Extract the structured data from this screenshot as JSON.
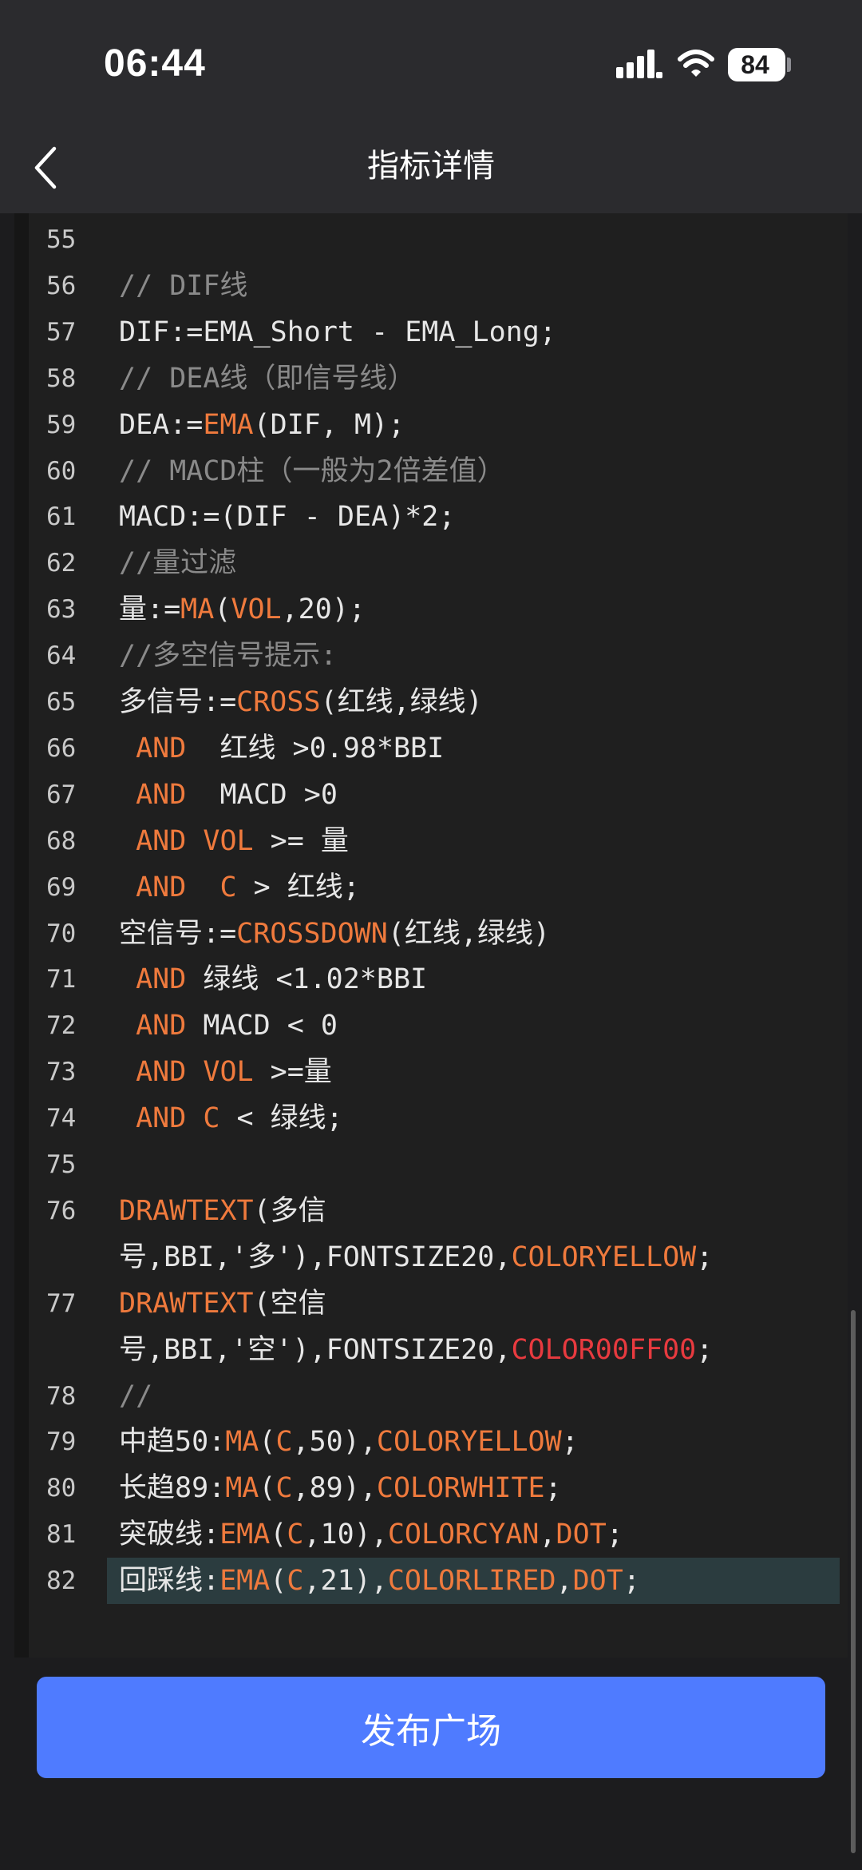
{
  "status_bar": {
    "time": "06:44",
    "battery": "84"
  },
  "nav": {
    "title": "指标详情"
  },
  "publish": {
    "label": "发布广场"
  },
  "colors": {
    "accent": "#4f7bff",
    "keyword": "#ef7a3d",
    "red": "#e83a3f",
    "comment": "#8a8a8a"
  },
  "code": [
    {
      "n": "55",
      "segs": []
    },
    {
      "n": "56",
      "segs": [
        [
          "cm",
          "// DIF线"
        ]
      ]
    },
    {
      "n": "57",
      "segs": [
        [
          "",
          "DIF:=EMA_Short - EMA_Long;"
        ]
      ]
    },
    {
      "n": "58",
      "segs": [
        [
          "cm",
          "// DEA线（即信号线）"
        ]
      ]
    },
    {
      "n": "59",
      "segs": [
        [
          "",
          "DEA:="
        ],
        [
          "kw",
          "EMA"
        ],
        [
          "",
          "(DIF, M);"
        ]
      ]
    },
    {
      "n": "60",
      "segs": [
        [
          "cm",
          "// MACD柱（一般为2倍差值）"
        ]
      ]
    },
    {
      "n": "61",
      "segs": [
        [
          "",
          "MACD:=(DIF - DEA)*2;"
        ]
      ]
    },
    {
      "n": "62",
      "segs": [
        [
          "cm",
          "//量过滤"
        ]
      ]
    },
    {
      "n": "63",
      "segs": [
        [
          "",
          "量:="
        ],
        [
          "kw",
          "MA"
        ],
        [
          "",
          "("
        ],
        [
          "kw",
          "VOL"
        ],
        [
          "",
          ",20);"
        ]
      ]
    },
    {
      "n": "64",
      "segs": [
        [
          "cm",
          "//多空信号提示:"
        ]
      ]
    },
    {
      "n": "65",
      "segs": [
        [
          "",
          "多信号:="
        ],
        [
          "kw",
          "CROSS"
        ],
        [
          "",
          "(红线,绿线)"
        ]
      ]
    },
    {
      "n": "66",
      "segs": [
        [
          "",
          " "
        ],
        [
          "kw",
          "AND"
        ],
        [
          "",
          "  红线 >0.98*BBI"
        ]
      ]
    },
    {
      "n": "67",
      "segs": [
        [
          "",
          " "
        ],
        [
          "kw",
          "AND"
        ],
        [
          "",
          "  MACD >0"
        ]
      ]
    },
    {
      "n": "68",
      "segs": [
        [
          "",
          " "
        ],
        [
          "kw",
          "AND"
        ],
        [
          "",
          " "
        ],
        [
          "kw",
          "VOL"
        ],
        [
          "",
          " >= 量"
        ]
      ]
    },
    {
      "n": "69",
      "segs": [
        [
          "",
          " "
        ],
        [
          "kw",
          "AND"
        ],
        [
          "",
          "  "
        ],
        [
          "kw",
          "C"
        ],
        [
          "",
          " > 红线;"
        ]
      ]
    },
    {
      "n": "70",
      "segs": [
        [
          "",
          "空信号:="
        ],
        [
          "kw",
          "CROSSDOWN"
        ],
        [
          "",
          "(红线,绿线)"
        ]
      ]
    },
    {
      "n": "71",
      "segs": [
        [
          "",
          " "
        ],
        [
          "kw",
          "AND"
        ],
        [
          "",
          " 绿线 <1.02*BBI"
        ]
      ]
    },
    {
      "n": "72",
      "segs": [
        [
          "",
          " "
        ],
        [
          "kw",
          "AND"
        ],
        [
          "",
          " MACD < 0"
        ]
      ]
    },
    {
      "n": "73",
      "segs": [
        [
          "",
          " "
        ],
        [
          "kw",
          "AND"
        ],
        [
          "",
          " "
        ],
        [
          "kw",
          "VOL"
        ],
        [
          "",
          " >=量"
        ]
      ]
    },
    {
      "n": "74",
      "segs": [
        [
          "",
          " "
        ],
        [
          "kw",
          "AND"
        ],
        [
          "",
          " "
        ],
        [
          "kw",
          "C"
        ],
        [
          "",
          " < 绿线;"
        ]
      ]
    },
    {
      "n": "75",
      "segs": []
    },
    {
      "n": "76",
      "segs": [
        [
          "kw",
          "DRAWTEXT"
        ],
        [
          "",
          "(多信"
        ]
      ]
    },
    {
      "n": "",
      "segs": [
        [
          "",
          "号,BBI,'多'),FONTSIZE20,"
        ],
        [
          "kw",
          "COLORYELLOW"
        ],
        [
          "",
          ";"
        ]
      ]
    },
    {
      "n": "77",
      "segs": [
        [
          "kw",
          "DRAWTEXT"
        ],
        [
          "",
          "(空信"
        ]
      ]
    },
    {
      "n": "",
      "segs": [
        [
          "",
          "号,BBI,'空'),FONTSIZE20,"
        ],
        [
          "rd",
          "COLOR00FF00"
        ],
        [
          "",
          ";"
        ]
      ]
    },
    {
      "n": "78",
      "segs": [
        [
          "cm",
          "//"
        ]
      ]
    },
    {
      "n": "79",
      "segs": [
        [
          "",
          "中趋50:"
        ],
        [
          "kw",
          "MA"
        ],
        [
          "",
          "("
        ],
        [
          "kw",
          "C"
        ],
        [
          "",
          ",50),"
        ],
        [
          "kw",
          "COLORYELLOW"
        ],
        [
          "",
          ";"
        ]
      ]
    },
    {
      "n": "80",
      "segs": [
        [
          "",
          "长趋89:"
        ],
        [
          "kw",
          "MA"
        ],
        [
          "",
          "("
        ],
        [
          "kw",
          "C"
        ],
        [
          "",
          ",89),"
        ],
        [
          "kw",
          "COLORWHITE"
        ],
        [
          "",
          ";"
        ]
      ]
    },
    {
      "n": "81",
      "segs": [
        [
          "",
          "突破线:"
        ],
        [
          "kw",
          "EMA"
        ],
        [
          "",
          "("
        ],
        [
          "kw",
          "C"
        ],
        [
          "",
          ",10),"
        ],
        [
          "kw",
          "COLORCYAN"
        ],
        [
          "",
          ","
        ],
        [
          "kw",
          "DOT"
        ],
        [
          "",
          ";"
        ]
      ]
    },
    {
      "n": "82",
      "segs": [
        [
          "",
          "回踩线:"
        ],
        [
          "kw",
          "EMA"
        ],
        [
          "",
          "("
        ],
        [
          "kw",
          "C"
        ],
        [
          "",
          ",21),"
        ],
        [
          "kw",
          "COLORLIRED"
        ],
        [
          "",
          ","
        ],
        [
          "kw",
          "DOT"
        ],
        [
          "",
          ";"
        ]
      ],
      "highlight": true
    }
  ]
}
